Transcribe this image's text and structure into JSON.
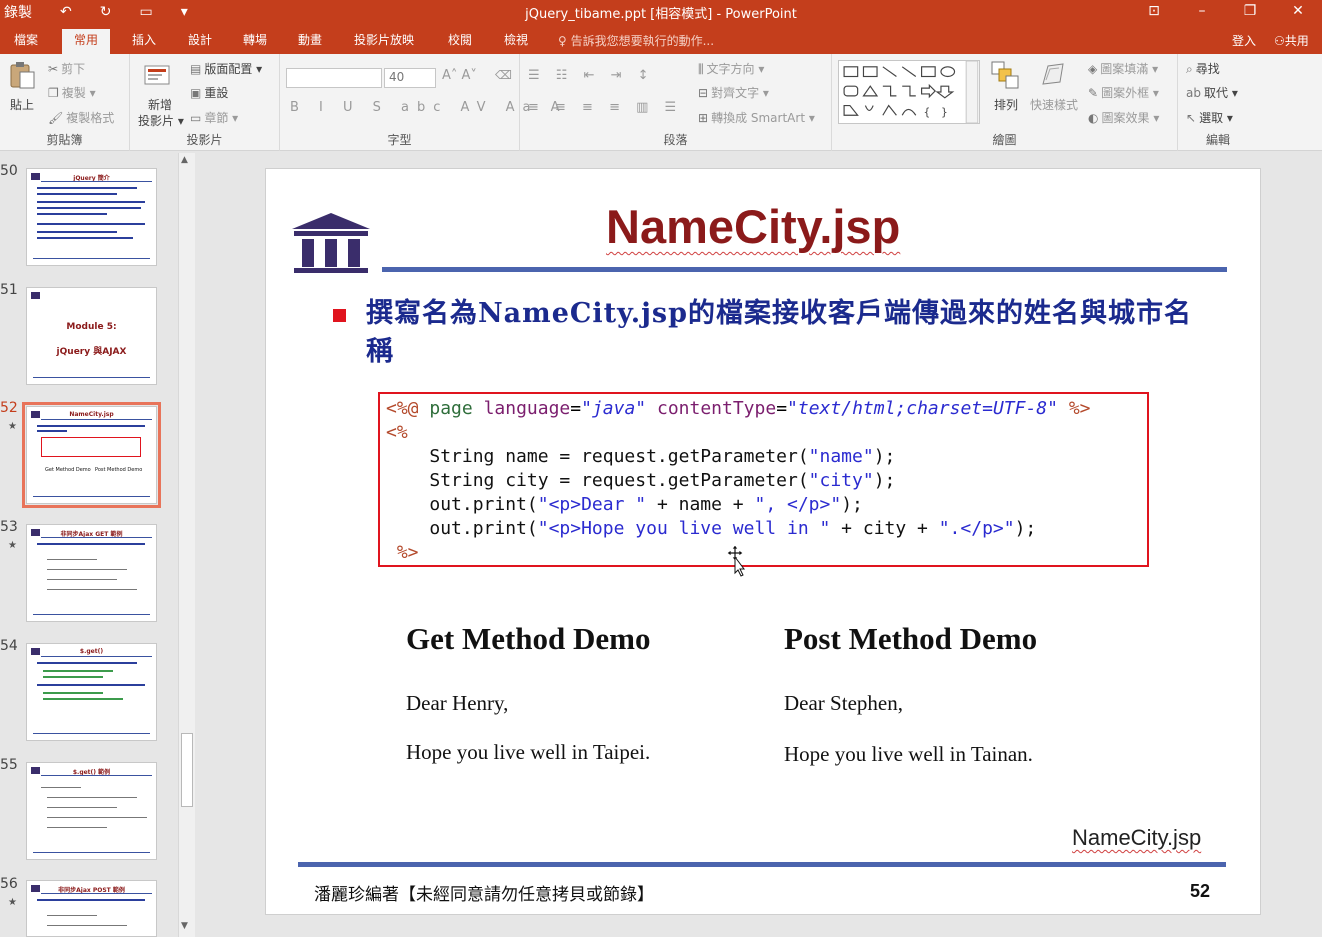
{
  "titlebar": {
    "qat_label": "錄製",
    "doc_title": "jQuery_tibame.ppt [相容模式] - PowerPoint"
  },
  "tabs": [
    {
      "label": "檔案"
    },
    {
      "label": "常用"
    },
    {
      "label": "插入"
    },
    {
      "label": "設計"
    },
    {
      "label": "轉場"
    },
    {
      "label": "動畫"
    },
    {
      "label": "投影片放映"
    },
    {
      "label": "校閱"
    },
    {
      "label": "檢視"
    }
  ],
  "tellme": "告訴我您想要執行的動作...",
  "account": {
    "login": "登入",
    "share": "共用"
  },
  "ribbon": {
    "clipboard": {
      "label": "剪貼簿",
      "paste": "貼上",
      "cut": "剪下",
      "copy": "複製",
      "format_painter": "複製格式"
    },
    "slides": {
      "label": "投影片",
      "new_slide_1": "新增",
      "new_slide_2": "投影片",
      "layout": "版面配置",
      "reset": "重設",
      "section": "章節"
    },
    "font": {
      "label": "字型",
      "font_name": "",
      "font_size": "40"
    },
    "paragraph": {
      "label": "段落",
      "text_direction": "文字方向",
      "align_text": "對齊文字",
      "smartart": "轉換成 SmartArt"
    },
    "drawing": {
      "label": "繪圖",
      "arrange": "排列",
      "quick_styles": "快速樣式",
      "shape_fill": "圖案填滿",
      "shape_outline": "圖案外框",
      "shape_effects": "圖案效果"
    },
    "editing": {
      "label": "編輯",
      "find": "尋找",
      "replace": "取代",
      "select": "選取"
    }
  },
  "thumbnails": [
    {
      "num": "50",
      "title": "jQuery 簡介",
      "star": ""
    },
    {
      "num": "51",
      "title": "Module 5:",
      "subtitle": "jQuery 與AJAX",
      "star": ""
    },
    {
      "num": "52",
      "title": "NameCity.jsp",
      "star": "★",
      "selected": true
    },
    {
      "num": "53",
      "title": "非同步Ajax GET 範例",
      "star": "★"
    },
    {
      "num": "54",
      "title": "$.get()",
      "star": ""
    },
    {
      "num": "55",
      "title": "$.get() 範例",
      "star": ""
    },
    {
      "num": "56",
      "title": "非同步Ajax POST 範例",
      "star": "★"
    }
  ],
  "slide": {
    "title": "NameCity.jsp",
    "bullet": "撰寫名為NameCity.jsp的檔案接收客戶端傳過來的姓名與城市名稱",
    "code": {
      "l1_open": "<%@",
      "l1_page": "page",
      "l1_lang_attr": "language",
      "l1_lang_val": "\"java\"",
      "l1_ct_attr": "contentType",
      "l1_ct_val": "\"text/html;charset=UTF-8\"",
      "l1_close": "%>",
      "l2": "<%",
      "l3_a": "String name = request.getParameter(",
      "l3_s": "\"name\"",
      "l3_b": ");",
      "l4_a": "String city = request.getParameter(",
      "l4_s": "\"city\"",
      "l4_b": ");",
      "l5_a": "out.print(",
      "l5_s1": "\"<p>Dear \"",
      "l5_b": " + name + ",
      "l5_s2": "\", </p>\"",
      "l5_c": ");",
      "l6_a": "out.print(",
      "l6_s1": "\"<p>Hope you live well in \"",
      "l6_b": " + city + ",
      "l6_s2": "\".</p>\"",
      "l6_c": ");",
      "l7": "%>"
    },
    "get_demo": {
      "heading": "Get Method Demo",
      "line1": "Dear Henry,",
      "line2": "Hope you live well in Taipei."
    },
    "post_demo": {
      "heading": "Post Method Demo",
      "line1": "Dear Stephen,",
      "line2": "Hope you live well in Tainan."
    },
    "file_label": "NameCity.jsp",
    "footer_left": "潘麗珍編著【未經同意請勿任意拷貝或節錄】",
    "page_num": "52"
  },
  "colors": {
    "accent": "#c43e1c",
    "title_red": "#8b1a1a",
    "bullet_blue": "#1b2a8e",
    "rule_blue": "#4b64ae",
    "box_red": "#e0141e"
  }
}
